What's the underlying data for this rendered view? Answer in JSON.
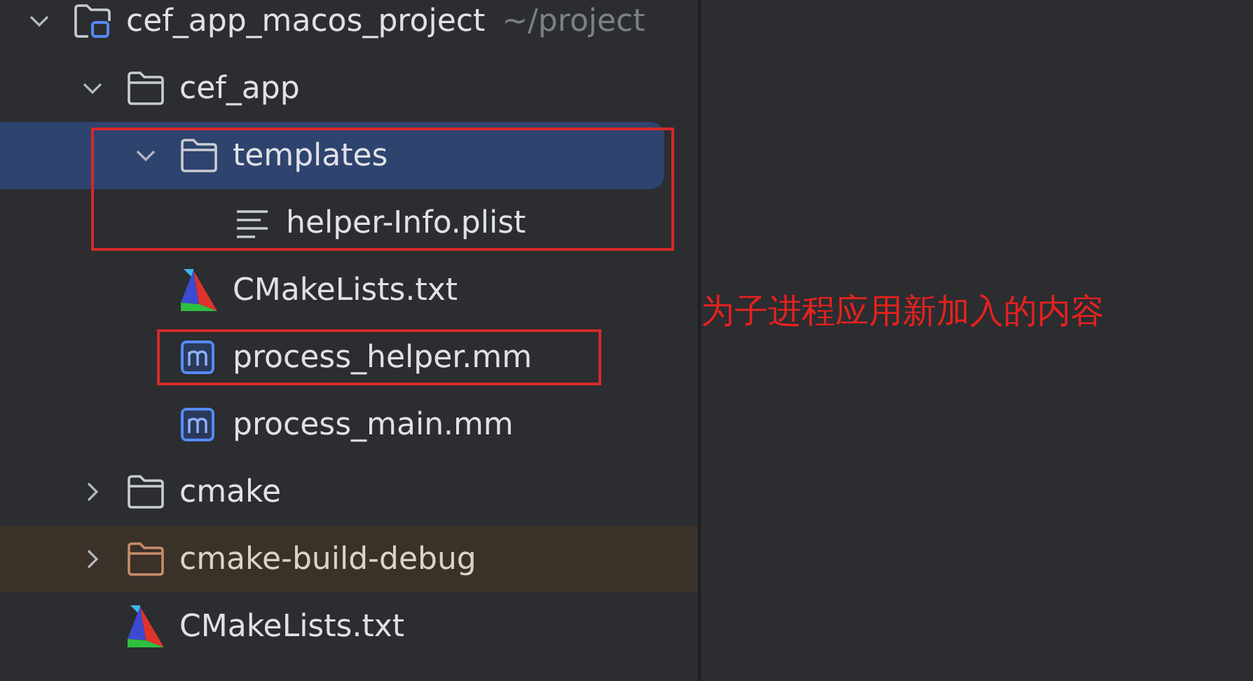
{
  "project_tree": [
    {
      "label": "cef_app_macos_project",
      "path": "~/project",
      "kind": "project",
      "expanded": true,
      "selected": false,
      "excluded": false,
      "outlined": false,
      "children": [
        {
          "label": "cef_app",
          "kind": "folder",
          "expanded": true,
          "selected": false,
          "excluded": false,
          "outlined": false,
          "children": [
            {
              "label": "templates",
              "kind": "folder",
              "expanded": true,
              "selected": true,
              "excluded": false,
              "outlined": true,
              "children": [
                {
                  "label": "helper-Info.plist",
                  "kind": "plist",
                  "selected": false,
                  "excluded": false,
                  "outlined": false
                }
              ]
            },
            {
              "label": "CMakeLists.txt",
              "kind": "cmake",
              "selected": false,
              "excluded": false,
              "outlined": false
            },
            {
              "label": "process_helper.mm",
              "kind": "objc",
              "selected": false,
              "excluded": false,
              "outlined": true
            },
            {
              "label": "process_main.mm",
              "kind": "objc",
              "selected": false,
              "excluded": false,
              "outlined": false
            }
          ]
        },
        {
          "label": "cmake",
          "kind": "folder",
          "expanded": false,
          "selected": false,
          "excluded": false,
          "outlined": false
        },
        {
          "label": "cmake-build-debug",
          "kind": "folder",
          "expanded": false,
          "selected": false,
          "excluded": true,
          "outlined": false
        },
        {
          "label": "CMakeLists.txt",
          "kind": "cmake",
          "selected": false,
          "excluded": false,
          "outlined": false
        }
      ]
    }
  ],
  "annotation": {
    "note": "为子进程应用新加入的内容"
  }
}
